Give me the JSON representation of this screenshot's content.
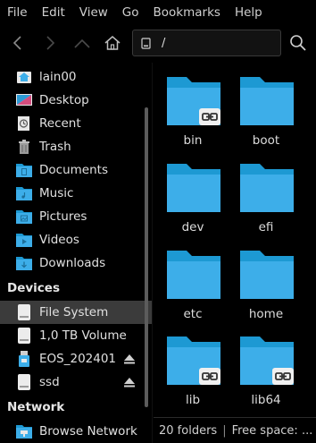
{
  "menu": [
    "File",
    "Edit",
    "View",
    "Go",
    "Bookmarks",
    "Help"
  ],
  "toolbar": {
    "path": "/",
    "back_icon": "chevron-left-icon",
    "forward_icon": "chevron-right-icon",
    "up_icon": "chevron-up-icon",
    "home_icon": "home-icon",
    "search_icon": "search-icon"
  },
  "sidebar": {
    "places": [
      {
        "label": "lain00",
        "icon": "user-home-icon"
      },
      {
        "label": "Desktop",
        "icon": "desktop-icon"
      },
      {
        "label": "Recent",
        "icon": "recent-icon"
      },
      {
        "label": "Trash",
        "icon": "trash-icon"
      },
      {
        "label": "Documents",
        "icon": "documents-folder-icon"
      },
      {
        "label": "Music",
        "icon": "music-folder-icon"
      },
      {
        "label": "Pictures",
        "icon": "pictures-folder-icon"
      },
      {
        "label": "Videos",
        "icon": "videos-folder-icon"
      },
      {
        "label": "Downloads",
        "icon": "downloads-folder-icon"
      }
    ],
    "devices_header": "Devices",
    "devices": [
      {
        "label": "File System",
        "icon": "drive-icon",
        "selected": true
      },
      {
        "label": "1,0 TB Volume",
        "icon": "drive-icon"
      },
      {
        "label": "EOS_202401",
        "icon": "usb-drive-icon",
        "eject": true
      },
      {
        "label": "ssd",
        "icon": "drive-icon",
        "eject": true
      }
    ],
    "network_header": "Network",
    "network": [
      {
        "label": "Browse Network",
        "icon": "network-folder-icon"
      }
    ]
  },
  "folders": [
    {
      "name": "bin",
      "symlink": true
    },
    {
      "name": "boot",
      "symlink": false
    },
    {
      "name": "dev",
      "symlink": false
    },
    {
      "name": "efi",
      "symlink": false
    },
    {
      "name": "etc",
      "symlink": false
    },
    {
      "name": "home",
      "symlink": false
    },
    {
      "name": "lib",
      "symlink": true
    },
    {
      "name": "lib64",
      "symlink": true
    }
  ],
  "status": {
    "count": "20 folders",
    "free": "Free space: ..."
  },
  "colors": {
    "folder_blue": "#3daee9",
    "folder_tab": "#1d99d3",
    "selection": "#3b3b3b"
  }
}
